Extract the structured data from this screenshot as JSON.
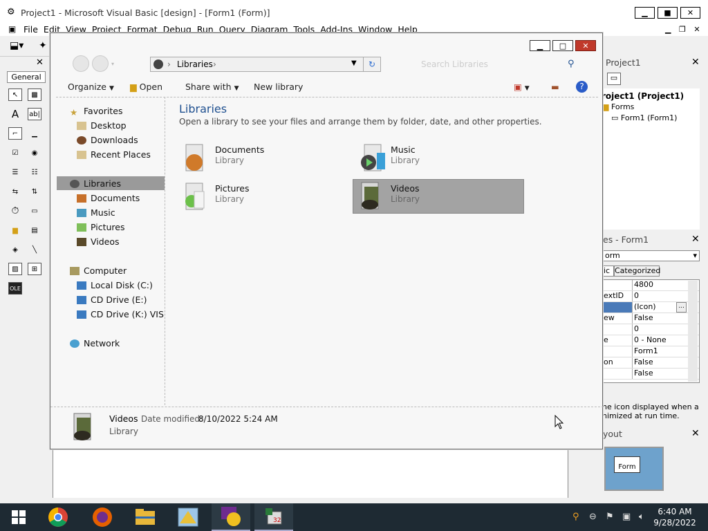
{
  "vb": {
    "title": "Project1 - Microsoft Visual Basic [design] - [Form1 (Form)]",
    "menu": [
      "File",
      "Edit",
      "View",
      "Project",
      "Format",
      "Debug",
      "Run",
      "Query",
      "Diagram",
      "Tools",
      "Add-Ins",
      "Window",
      "Help"
    ],
    "toolbox_title": "General",
    "project_panel_title": "Project1",
    "project_tree": {
      "root": "roject1 (Project1)",
      "folder": "Forms",
      "item": "Form1 (Form1)"
    },
    "properties_title": "es - Form1",
    "properties_object": "orm",
    "properties_tabs": {
      "alphabetic": "ic",
      "categorized": "Categorized"
    },
    "properties": [
      {
        "k": "",
        "v": "4800"
      },
      {
        "k": "extID",
        "v": "0"
      },
      {
        "k": "",
        "v": "(Icon)"
      },
      {
        "k": "ew",
        "v": "False"
      },
      {
        "k": "",
        "v": "0"
      },
      {
        "k": "e",
        "v": "0 - None"
      },
      {
        "k": "",
        "v": "Form1"
      },
      {
        "k": "on",
        "v": "False"
      },
      {
        "k": "",
        "v": "False"
      }
    ],
    "properties_desc_line1": "ne icon displayed when a",
    "properties_desc_line2": "nimized at run time.",
    "layout_title": "yout",
    "layout_form_label": "Form"
  },
  "explorer": {
    "address_crumb": "Libraries",
    "search_placeholder": "Search Libraries",
    "cmd": {
      "organize": "Organize",
      "open": "Open",
      "share_with": "Share with",
      "new_library": "New library"
    },
    "nav": {
      "favorites": "Favorites",
      "desktop": "Desktop",
      "downloads": "Downloads",
      "recent_places": "Recent Places",
      "libraries": "Libraries",
      "documents": "Documents",
      "music": "Music",
      "pictures": "Pictures",
      "videos": "Videos",
      "computer": "Computer",
      "local_disk": "Local Disk (C:)",
      "cd_e": "CD Drive (E:)",
      "cd_k": "CD Drive (K:) VISUAL",
      "network": "Network"
    },
    "heading": "Libraries",
    "description": "Open a library to see your files and arrange them by folder, date, and other properties.",
    "libraries": [
      {
        "name": "Documents",
        "type": "Library"
      },
      {
        "name": "Music",
        "type": "Library"
      },
      {
        "name": "Pictures",
        "type": "Library"
      },
      {
        "name": "Videos",
        "type": "Library"
      }
    ],
    "details": {
      "name": "Videos",
      "modified_label": "Date modified:",
      "modified_value": "8/10/2022 5:24 AM",
      "type": "Library"
    }
  },
  "taskbar": {
    "time": "6:40 AM",
    "date": "9/28/2022"
  },
  "colors": {
    "accent_blue": "#1e4f8f",
    "selection_gray": "#a3a3a3",
    "taskbar": "#1e2a33"
  }
}
